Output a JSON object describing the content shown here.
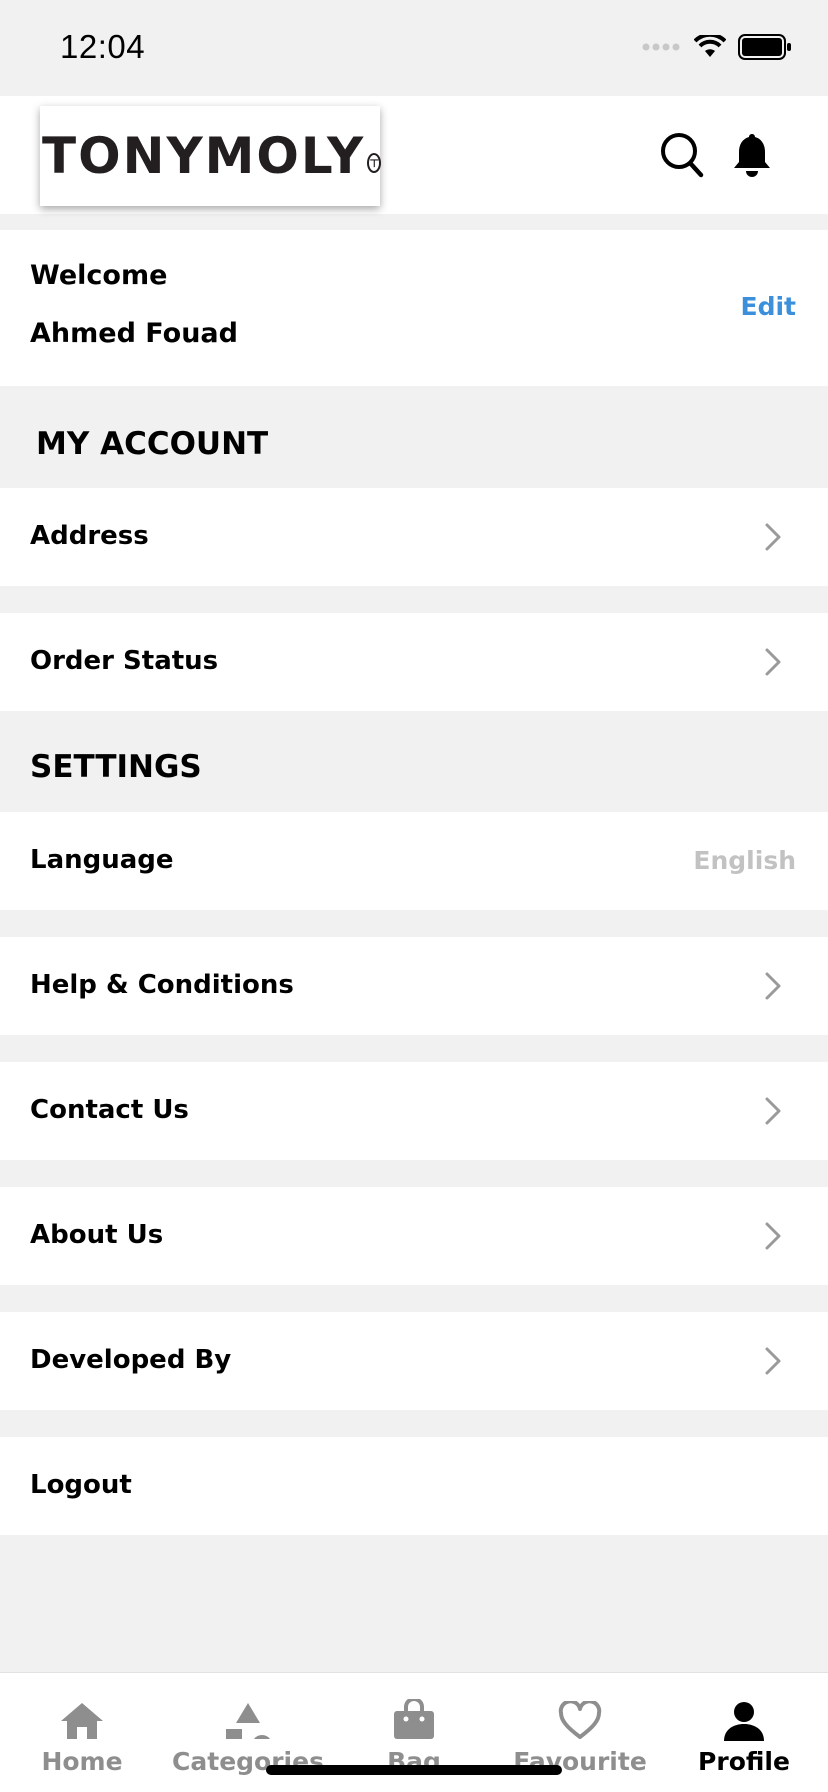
{
  "status_bar": {
    "time": "12:04"
  },
  "header": {
    "logo_text": "TONYMOLY",
    "search_icon": "search-icon",
    "notification_icon": "bell-icon"
  },
  "welcome": {
    "label": "Welcome",
    "name": "Ahmed Fouad",
    "edit_label": "Edit"
  },
  "my_account": {
    "title": "MY ACCOUNT",
    "items": [
      {
        "label": "Address"
      },
      {
        "label": "Order Status"
      }
    ]
  },
  "settings": {
    "title": "SETTINGS",
    "language": {
      "label": "Language",
      "value": "English"
    },
    "items": [
      {
        "label": "Help & Conditions"
      },
      {
        "label": "Contact Us"
      },
      {
        "label": "About Us"
      },
      {
        "label": "Developed By"
      }
    ],
    "logout_label": "Logout"
  },
  "tabbar": {
    "tabs": [
      {
        "label": "Home",
        "icon": "home-icon"
      },
      {
        "label": "Categories",
        "icon": "categories-icon"
      },
      {
        "label": "Bag",
        "icon": "bag-icon"
      },
      {
        "label": "Favourite",
        "icon": "heart-icon"
      },
      {
        "label": "Profile",
        "icon": "profile-icon"
      }
    ],
    "active": "Profile"
  },
  "colors": {
    "accent": "#3b8fdb",
    "background": "#f1f1f1",
    "muted": "#8e8e8e",
    "value_gray": "#c2c2c2"
  }
}
